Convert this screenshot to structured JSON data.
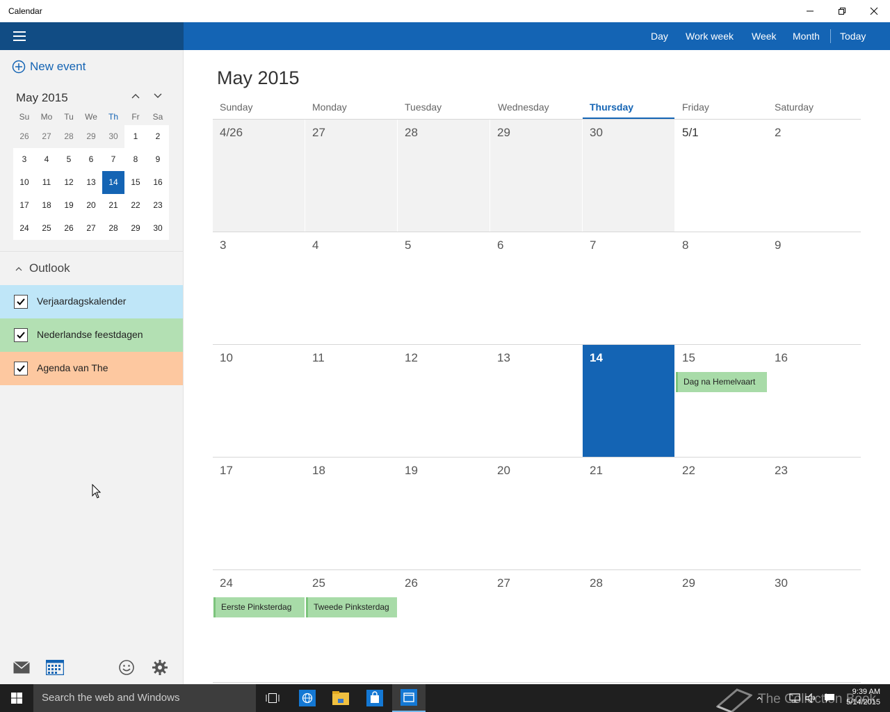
{
  "window": {
    "title": "Calendar"
  },
  "toolbar": {
    "views": [
      "Day",
      "Work week",
      "Week",
      "Month",
      "Today"
    ]
  },
  "sidebar": {
    "new_event_label": "New event",
    "mini_calendar": {
      "title": "May 2015",
      "weekdays": [
        "Su",
        "Mo",
        "Tu",
        "We",
        "Th",
        "Fr",
        "Sa"
      ],
      "weeks": [
        [
          "26",
          "27",
          "28",
          "29",
          "30",
          "1",
          "2"
        ],
        [
          "3",
          "4",
          "5",
          "6",
          "7",
          "8",
          "9"
        ],
        [
          "10",
          "11",
          "12",
          "13",
          "14",
          "15",
          "16"
        ],
        [
          "17",
          "18",
          "19",
          "20",
          "21",
          "22",
          "23"
        ],
        [
          "24",
          "25",
          "26",
          "27",
          "28",
          "29",
          "30"
        ]
      ],
      "selected": "14"
    },
    "account_label": "Outlook",
    "calendars": [
      {
        "label": "Verjaardagskalender",
        "color": "#bfe6f8",
        "checked": true
      },
      {
        "label": "Nederlandse feestdagen",
        "color": "#b3e0b3",
        "checked": true
      },
      {
        "label": "Agenda van The",
        "color": "#fdc8a0",
        "checked": true
      }
    ]
  },
  "main": {
    "month_title": "May 2015",
    "day_headers": [
      "Sunday",
      "Monday",
      "Tuesday",
      "Wednesday",
      "Thursday",
      "Friday",
      "Saturday"
    ],
    "weeks": [
      [
        "4/26",
        "27",
        "28",
        "29",
        "30",
        "5/1",
        "2"
      ],
      [
        "3",
        "4",
        "5",
        "6",
        "7",
        "8",
        "9"
      ],
      [
        "10",
        "11",
        "12",
        "13",
        "14",
        "15",
        "16"
      ],
      [
        "17",
        "18",
        "19",
        "20",
        "21",
        "22",
        "23"
      ],
      [
        "24",
        "25",
        "26",
        "27",
        "28",
        "29",
        "30"
      ]
    ],
    "events": [
      {
        "label": "Dag na Hemelvaart",
        "week": 2,
        "day": 5
      },
      {
        "label": "Eerste Pinksterdag",
        "week": 4,
        "day": 0
      },
      {
        "label": "Tweede Pinksterdag",
        "week": 4,
        "day": 1
      }
    ]
  },
  "taskbar": {
    "search_placeholder": "Search the web and Windows",
    "time": "9:39 AM",
    "date": "5/14/2015",
    "watermark": "The Collection Book"
  },
  "colors": {
    "accent": "#1464b4",
    "accent_dark": "#114c84",
    "holiday": "#a8dba8"
  }
}
